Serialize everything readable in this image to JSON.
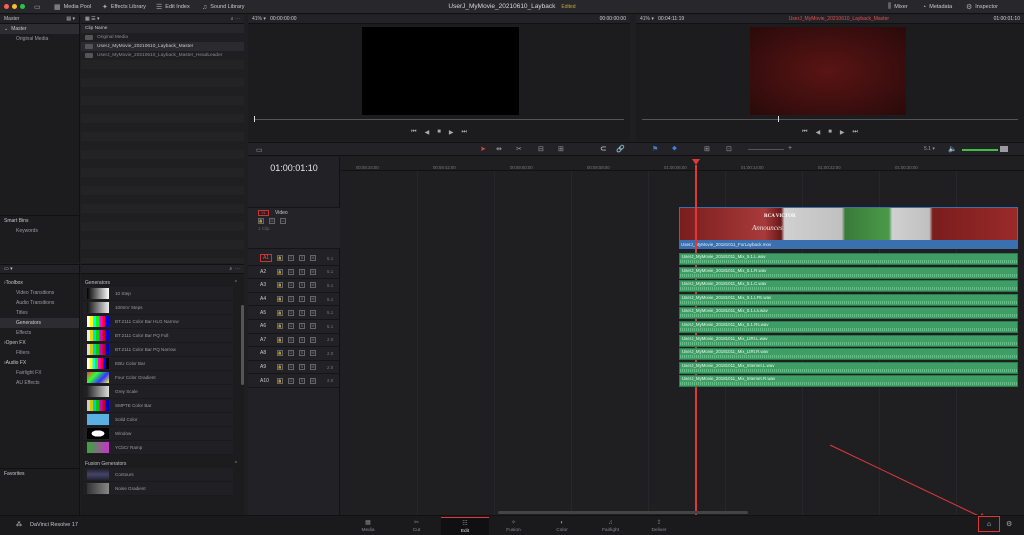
{
  "topbar": {
    "media_pool": "Media Pool",
    "effects_library": "Effects Library",
    "edit_index": "Edit Index",
    "sound_library": "Sound Library",
    "title": "UserJ_MyMovie_20210610_Layback",
    "status": "Edited",
    "mixer": "Mixer",
    "metadata": "Metadata",
    "inspector": "Inspector"
  },
  "mediapool": {
    "header": "Master",
    "bins": [
      "Master",
      "Original Media"
    ],
    "smart_bins": "Smart Bins",
    "smart_items": [
      "Keywords"
    ],
    "clip_col": "Clip Name",
    "clips": [
      "Original Media",
      "UserJ_MyMovie_20210610_Layback_Master",
      "UserJ_MyMovie_20210610_Layback_Master_HeadLeader"
    ]
  },
  "effects": {
    "tree": [
      {
        "label": "Toolbox",
        "head": true
      },
      {
        "label": "Video Transitions"
      },
      {
        "label": "Audio Transitions"
      },
      {
        "label": "Titles"
      },
      {
        "label": "Generators",
        "sel": true
      },
      {
        "label": "Effects"
      },
      {
        "label": "Open FX",
        "head": true
      },
      {
        "label": "Filters"
      },
      {
        "label": "Audio FX",
        "head": true
      },
      {
        "label": "Fairlight FX"
      },
      {
        "label": "AU Effects"
      }
    ],
    "favorites": "Favorites",
    "gen_header": "Generators",
    "generators": [
      "10 Step",
      "100mV Steps",
      "BT.2111 Color Bar HLG Narrow",
      "BT.2111 Color Bar PQ Full",
      "BT.2111 Color Bar PQ Narrow",
      "EBU Color Bar",
      "Four Color Gradient",
      "Grey Scale",
      "SMPTE Color Bar",
      "Solid Color",
      "Window",
      "YCbCr Ramp"
    ],
    "fusion_header": "Fusion Generators",
    "fusion": [
      "Contours",
      "Noise Gradient"
    ]
  },
  "source_viewer": {
    "zoom": "41%",
    "timecode_left": "00:00:00:00",
    "timecode_right": "00:00:00:00"
  },
  "timeline_viewer": {
    "zoom": "41%",
    "duration": "00:04:11:19",
    "name": "UserJ_MyMovie_20210610_Layback_Master",
    "timecode": "01:00:01:10"
  },
  "timeline": {
    "timecode": "01:00:01:10",
    "ruler": [
      "00:59:34:00",
      "00:59:42:00",
      "00:59:50:00",
      "00:59:58:00",
      "01:00:06:00",
      "01:00:14:00",
      "01:00:22:00",
      "01:00:30:00"
    ],
    "channel": "5.1",
    "video_track": {
      "id": "V1",
      "name": "Video",
      "clip_count": "1 Clip"
    },
    "video_clip": "UserJ_MyMovie_20181011_ForLayback.mov",
    "poster_title": "RCA VICTOR",
    "poster_sub": "Announces",
    "audio_tracks": [
      {
        "id": "A1",
        "ch": "5.1",
        "clip": "UserJ_MyMovie_20181011_Mix_5.1.L.wav"
      },
      {
        "id": "A2",
        "ch": "5.1",
        "clip": "UserJ_MyMovie_20181011_Mix_5.1.R.wav"
      },
      {
        "id": "A3",
        "ch": "5.1",
        "clip": "UserJ_MyMovie_20181011_Mix_5.1.C.wav"
      },
      {
        "id": "A4",
        "ch": "5.1",
        "clip": "UserJ_MyMovie_20181011_Mix_5.1.LFE.wav"
      },
      {
        "id": "A5",
        "ch": "5.1",
        "clip": "UserJ_MyMovie_20181011_Mix_5.1.Ls.wav"
      },
      {
        "id": "A6",
        "ch": "5.1",
        "clip": "UserJ_MyMovie_20181011_Mix_5.1.Rs.wav"
      },
      {
        "id": "A7",
        "ch": "2.0",
        "clip": "UserJ_MyMovie_20181011_Mix_LtRt.L.wav"
      },
      {
        "id": "A8",
        "ch": "2.0",
        "clip": "UserJ_MyMovie_20181011_Mix_LtRt.R.wav"
      },
      {
        "id": "A9",
        "ch": "2.0",
        "clip": "UserJ_MyMovie_20181011_Mix_Internet.L.wav"
      },
      {
        "id": "A10",
        "ch": "2.0",
        "clip": "UserJ_MyMovie_20181011_Mix_Internet.R.wav"
      }
    ]
  },
  "pages": [
    "Media",
    "Cut",
    "Edit",
    "Fusion",
    "Color",
    "Fairlight",
    "Deliver"
  ],
  "selected_page": "Edit",
  "app_name": "DaVinci Resolve 17",
  "colors": {
    "accent": "#e03838",
    "audio": "#3f9e66",
    "video_clip": "#3a6fb0"
  }
}
